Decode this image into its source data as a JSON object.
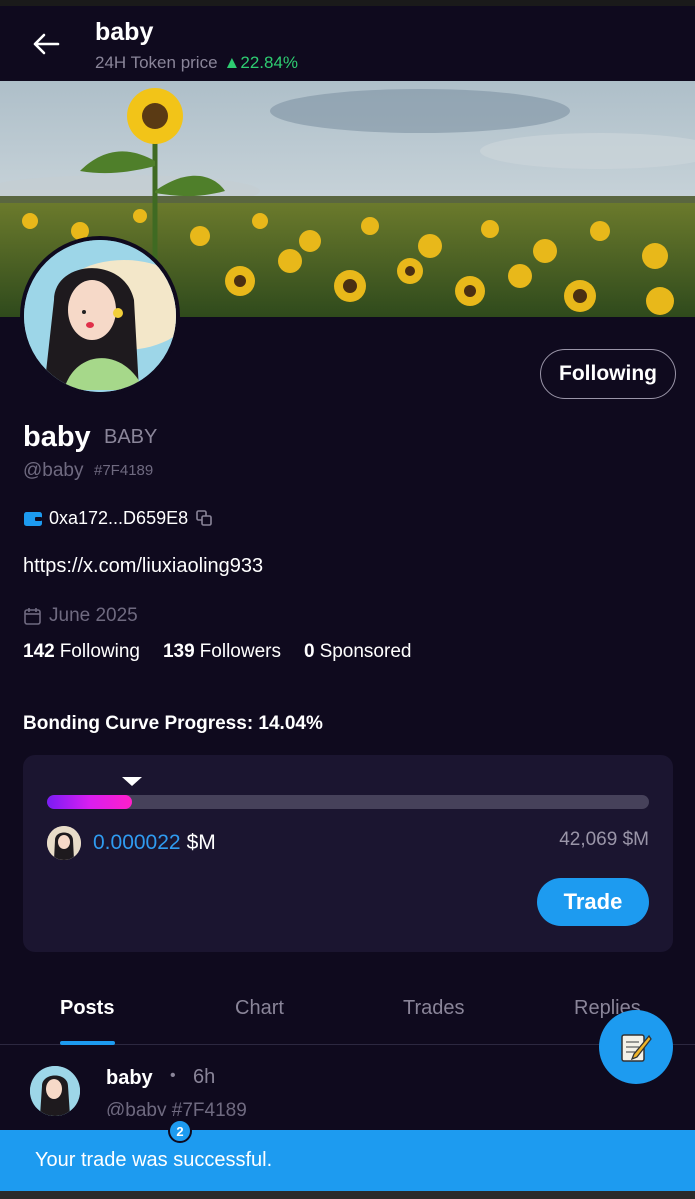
{
  "header": {
    "title": "baby",
    "subtitle": "24H Token price",
    "change": "▲22.84%"
  },
  "profile": {
    "follow_label": "Following",
    "name": "baby",
    "ticker": "BABY",
    "handle": "@baby",
    "handle_id": "#7F4189",
    "wallet": "0xa172...D659E8",
    "link": "https://x.com/liuxiaoling933",
    "joined": "June 2025",
    "stats": [
      {
        "count": "142",
        "label": "Following"
      },
      {
        "count": "139",
        "label": "Followers"
      },
      {
        "count": "0",
        "label": "Sponsored"
      }
    ]
  },
  "bonding": {
    "label": "Bonding Curve Progress: 14.04%",
    "progress_percent": 14.04,
    "price": "0.000022",
    "price_unit": "$M",
    "max": "42,069 $M",
    "trade_label": "Trade"
  },
  "tabs": [
    {
      "label": "Posts",
      "active": true
    },
    {
      "label": "Chart",
      "active": false
    },
    {
      "label": "Trades",
      "active": false
    },
    {
      "label": "Replies",
      "active": false
    }
  ],
  "post": {
    "name": "baby",
    "dot": "•",
    "time": "6h",
    "handle": "@baby #7F4189"
  },
  "toast": {
    "message": "Your trade was successful.",
    "badge": "2"
  },
  "colors": {
    "background": "#0f0a1e",
    "accent": "#1d9bf0",
    "positive": "#2ecc71"
  }
}
